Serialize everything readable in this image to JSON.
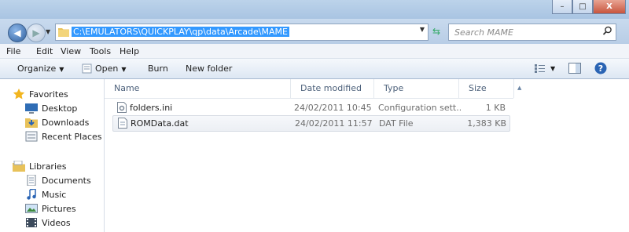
{
  "window": {
    "minimize_glyph": "–",
    "maximize_glyph": "□",
    "close_glyph": "X"
  },
  "address": {
    "path": "C:\\EMULATORS\\QUICKPLAY\\qp\\data\\Arcade\\MAME"
  },
  "search": {
    "placeholder": "Search MAME"
  },
  "menu": {
    "file": "File",
    "edit": "Edit",
    "view": "View",
    "tools": "Tools",
    "help": "Help"
  },
  "commands": {
    "organize": "Organize",
    "open": "Open",
    "burn": "Burn",
    "new_folder": "New folder"
  },
  "nav": {
    "favorites": "Favorites",
    "desktop": "Desktop",
    "downloads": "Downloads",
    "recent": "Recent Places",
    "libraries": "Libraries",
    "documents": "Documents",
    "music": "Music",
    "pictures": "Pictures",
    "videos": "Videos"
  },
  "columns": {
    "name": "Name",
    "date": "Date modified",
    "type": "Type",
    "size": "Size"
  },
  "files": [
    {
      "name": "folders.ini",
      "date": "24/02/2011 10:45",
      "type": "Configuration sett...",
      "size": "1 KB"
    },
    {
      "name": "ROMData.dat",
      "date": "24/02/2011 11:57",
      "type": "DAT File",
      "size": "1,383 KB"
    }
  ]
}
